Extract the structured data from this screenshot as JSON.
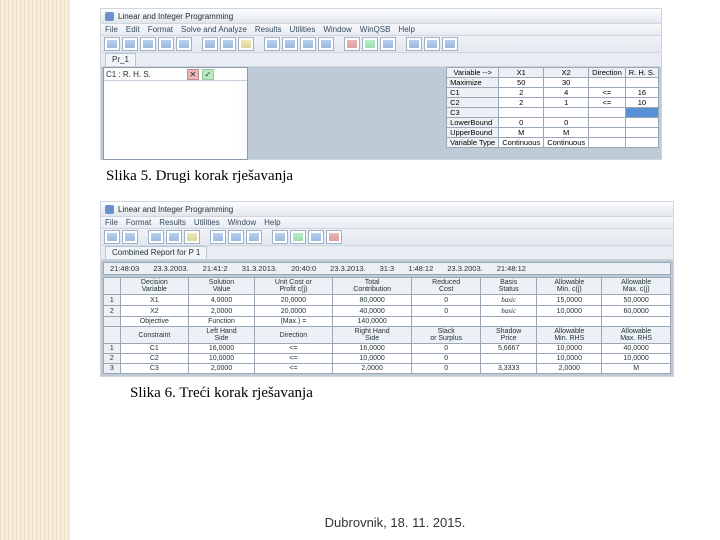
{
  "sidebar_stripe": true,
  "fig5": {
    "title": "Linear and Integer Programming",
    "menus": [
      "File",
      "Edit",
      "Format",
      "Solve and Analyze",
      "Results",
      "Utilities",
      "Window",
      "WinQSB",
      "Help"
    ],
    "tab1": "Pr_1",
    "leftpanel": {
      "cell_label": "C1 : R. H. S."
    },
    "grid": {
      "headers": [
        "Variable -->",
        "X1",
        "X2",
        "Direction",
        "R. H. S."
      ],
      "rows": [
        [
          "Maximize",
          "50",
          "30",
          "",
          ""
        ],
        [
          "C1",
          "2",
          "4",
          "<=",
          "16"
        ],
        [
          "C2",
          "2",
          "1",
          "<=",
          "10"
        ],
        [
          "C3",
          "",
          "",
          "",
          ""
        ],
        [
          "LowerBound",
          "0",
          "0",
          "",
          ""
        ],
        [
          "UpperBound",
          "M",
          "M",
          "",
          ""
        ],
        [
          "Variable Type",
          "Continuous",
          "Continuous",
          "",
          ""
        ]
      ],
      "selected_row": 3
    },
    "caption": "Slika 5.  Drugi korak rješavanja"
  },
  "fig6": {
    "title": "Linear and Integer Programming",
    "menus": [
      "File",
      "Format",
      "Results",
      "Utilities",
      "Window",
      "Help"
    ],
    "tab1": "Combined Report for P 1",
    "timerow": [
      "21:48:03",
      "23.3.2003.",
      "21:41:2",
      "31.3.2013.",
      "20:40:0",
      "23.3.2013.",
      "31:3",
      "1:48:12",
      "23.3.2003.",
      "21:48:12"
    ],
    "headers1": [
      "",
      "Decision\nVariable",
      "Solution\nValue",
      "Unit Cost or\nProfit c(j)",
      "Total\nContribution",
      "Reduced\nCost",
      "Basis\nStatus",
      "Allowable\nMin. c(j)",
      "Allowable\nMax. c(j)"
    ],
    "rows1": [
      [
        "1",
        "X1",
        "4,0000",
        "20,0000",
        "80,0000",
        "0",
        "basic",
        "15,0000",
        "50,0000"
      ],
      [
        "2",
        "X2",
        "2,0000",
        "20,0000",
        "40,0000",
        "0",
        "basic",
        "10,0000",
        "60,0000"
      ],
      [
        "",
        "Objective",
        "Function",
        "(Max.) =",
        "140,0000",
        "",
        "",
        "",
        ""
      ]
    ],
    "headers2": [
      "Constraint",
      "Left Hand\nSide",
      "Direction",
      "Right Hand\nSide",
      "Slack\nor Surplus",
      "Shadow\nPrice",
      "Allowable\nMin. RHS",
      "Allowable\nMax. RHS"
    ],
    "rows2": [
      [
        "1",
        "C1",
        "16,0000",
        "<=",
        "16,0000",
        "0",
        "5,6667",
        "10,0000",
        "40,0000"
      ],
      [
        "2",
        "C2",
        "10,0000",
        "<=",
        "10,0000",
        "0",
        "",
        "10,0000",
        "10,0000"
      ],
      [
        "3",
        "C3",
        "2,0000",
        "<=",
        "2,0000",
        "0",
        "3,3333",
        "2,0000",
        "M"
      ]
    ],
    "caption": "Slika  6. Treći korak rješavanja"
  },
  "footer": "Dubrovnik, 18. 11. 2015."
}
